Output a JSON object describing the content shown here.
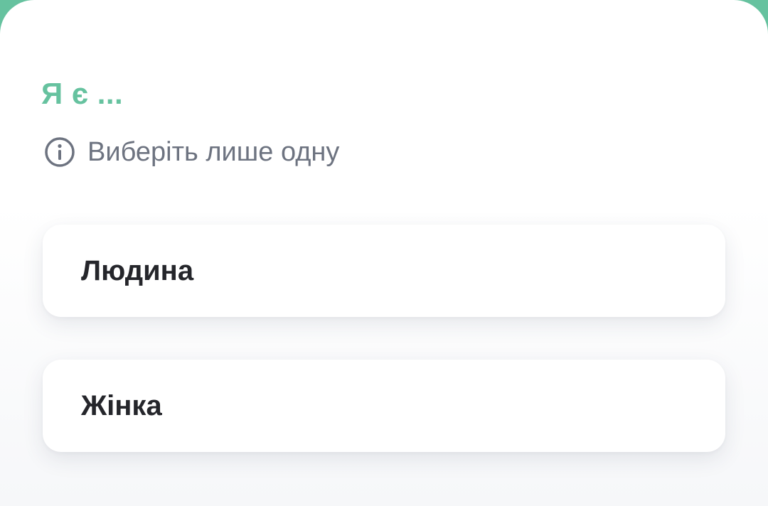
{
  "question": {
    "title": "Я є ..."
  },
  "hint": {
    "icon": "info-icon",
    "text": "Виберіть лише одну"
  },
  "options": [
    {
      "label": "Людина"
    },
    {
      "label": "Жінка"
    }
  ],
  "colors": {
    "accent": "#66c29f",
    "hint_text": "#6d7380",
    "option_text": "#25262b",
    "card_background": "#ffffff"
  }
}
